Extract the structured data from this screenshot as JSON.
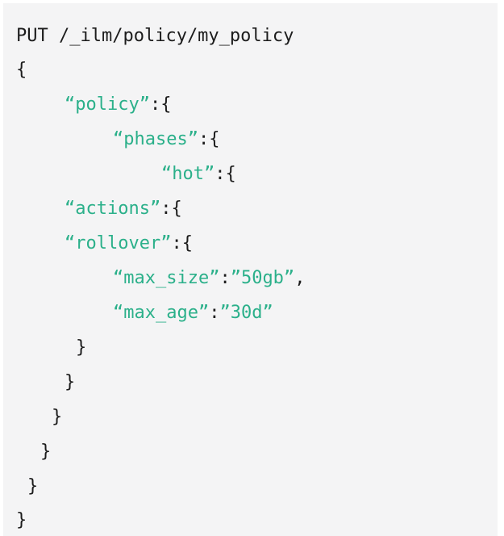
{
  "request": {
    "method": "PUT",
    "path": "/_ilm/policy/my_policy"
  },
  "code": {
    "open_brace": "{",
    "policy_key": "“policy”",
    "phases_key": "“phases”",
    "hot_key": "“hot”",
    "actions_key": "“actions”",
    "rollover_key": "“rollover”",
    "max_size_key": "“max_size”",
    "max_size_value": "”50gb”",
    "max_age_key": "“max_age”",
    "max_age_value": "”30d”",
    "close_brace": "}",
    "colon_brace": ":{",
    "colon": ":",
    "comma": ","
  },
  "colors": {
    "background": "#f4f4f5",
    "text": "#1c1c1c",
    "string": "#2bb08a"
  }
}
